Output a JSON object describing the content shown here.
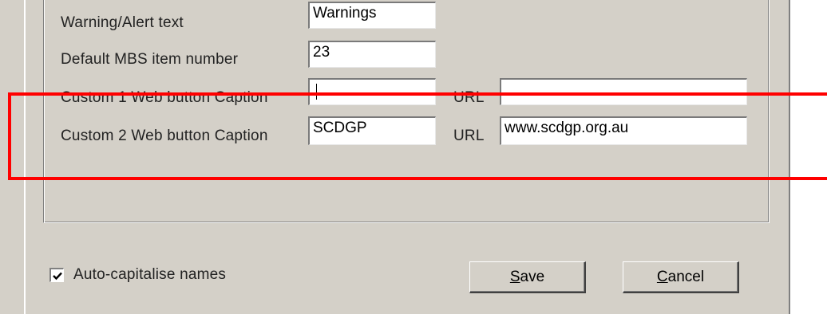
{
  "form": {
    "warning_label": "Warning/Alert text",
    "warning_value": "Warnings",
    "mbs_label": "Default MBS item number",
    "mbs_value": "23",
    "custom1_label": "Custom 1 Web button Caption",
    "custom1_value": "",
    "custom1_url_label": "URL",
    "custom1_url_value": "",
    "custom2_label": "Custom 2 Web button Caption",
    "custom2_value": "SCDGP",
    "custom2_url_label": "URL",
    "custom2_url_value": "www.scdgp.org.au"
  },
  "options": {
    "auto_capitalise_label": "Auto-capitalise names",
    "auto_capitalise_checked": true
  },
  "buttons": {
    "save_first": "S",
    "save_rest": "ave",
    "cancel_first": "C",
    "cancel_rest": "ancel"
  },
  "annotation": {
    "highlight_color": "#ff0000"
  },
  "colors": {
    "dialog_bg": "#d4d0c8",
    "field_bg": "#ffffff"
  }
}
